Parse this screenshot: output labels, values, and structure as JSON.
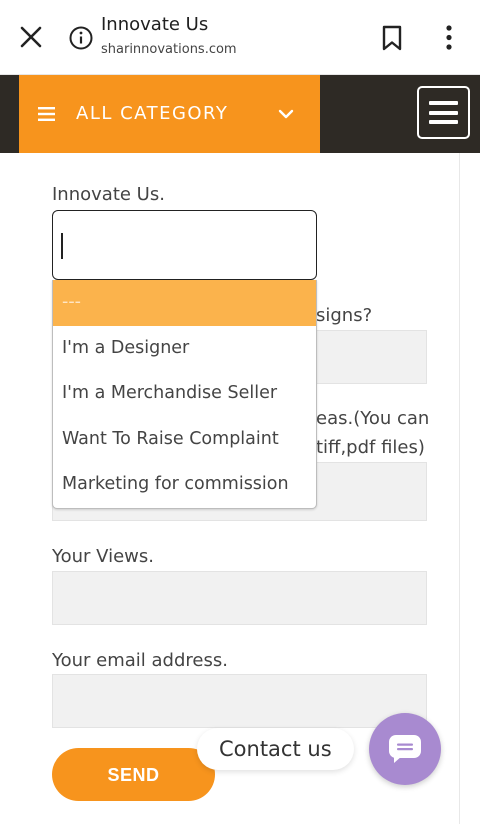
{
  "browser": {
    "title": "Innovate  Us",
    "url": "sharinnovations.com"
  },
  "header": {
    "category_label": "ALL CATEGORY",
    "accent_color": "#f7941d",
    "dark_color": "#2e2a25"
  },
  "form": {
    "heading": "Innovate Us.",
    "select_value": "",
    "options": [
      "---",
      "I'm a Designer",
      "I'm a Merchandise Seller",
      "Want To Raise Complaint",
      "Marketing for commission"
    ],
    "selected_option": "---",
    "q2_tail": "signs?",
    "q3_tail_line1": "eas.(You can",
    "q3_tail_line2": "tiff,pdf files)",
    "views_label": "Your Views.",
    "email_label": "Your email address.",
    "send_label": "SEND"
  },
  "contact": {
    "label": "Contact us",
    "fab_color": "#a88ad0"
  }
}
